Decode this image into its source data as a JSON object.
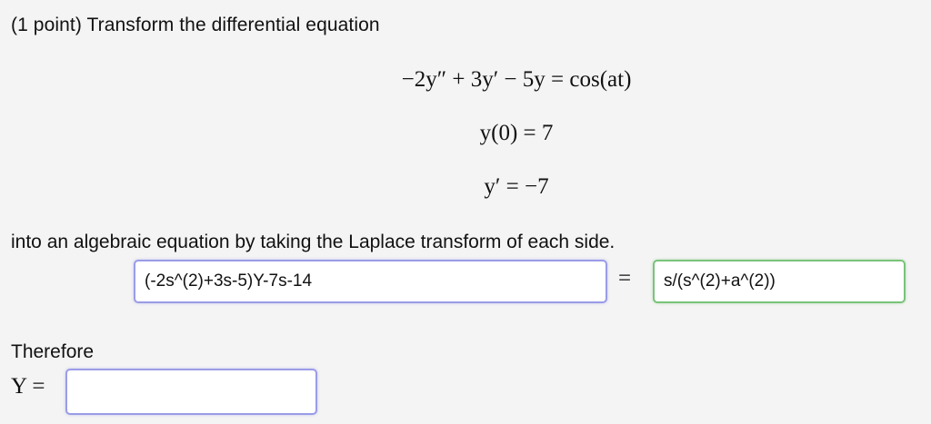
{
  "problem": {
    "intro": "(1 point) Transform the differential equation",
    "equation": "−2y″ + 3y′ − 5y = cos(at)",
    "initial_condition_1": "y(0) = 7",
    "initial_condition_2": "y′ = −7",
    "instruction": "into an algebraic equation by taking the Laplace transform of each side."
  },
  "answer": {
    "lhs_value": "(-2s^(2)+3s-5)Y-7s-14",
    "equals": "=",
    "rhs_value": "s/(s^(2)+a^(2))"
  },
  "result": {
    "therefore": "Therefore",
    "y_label": "Y =",
    "y_value": ""
  }
}
